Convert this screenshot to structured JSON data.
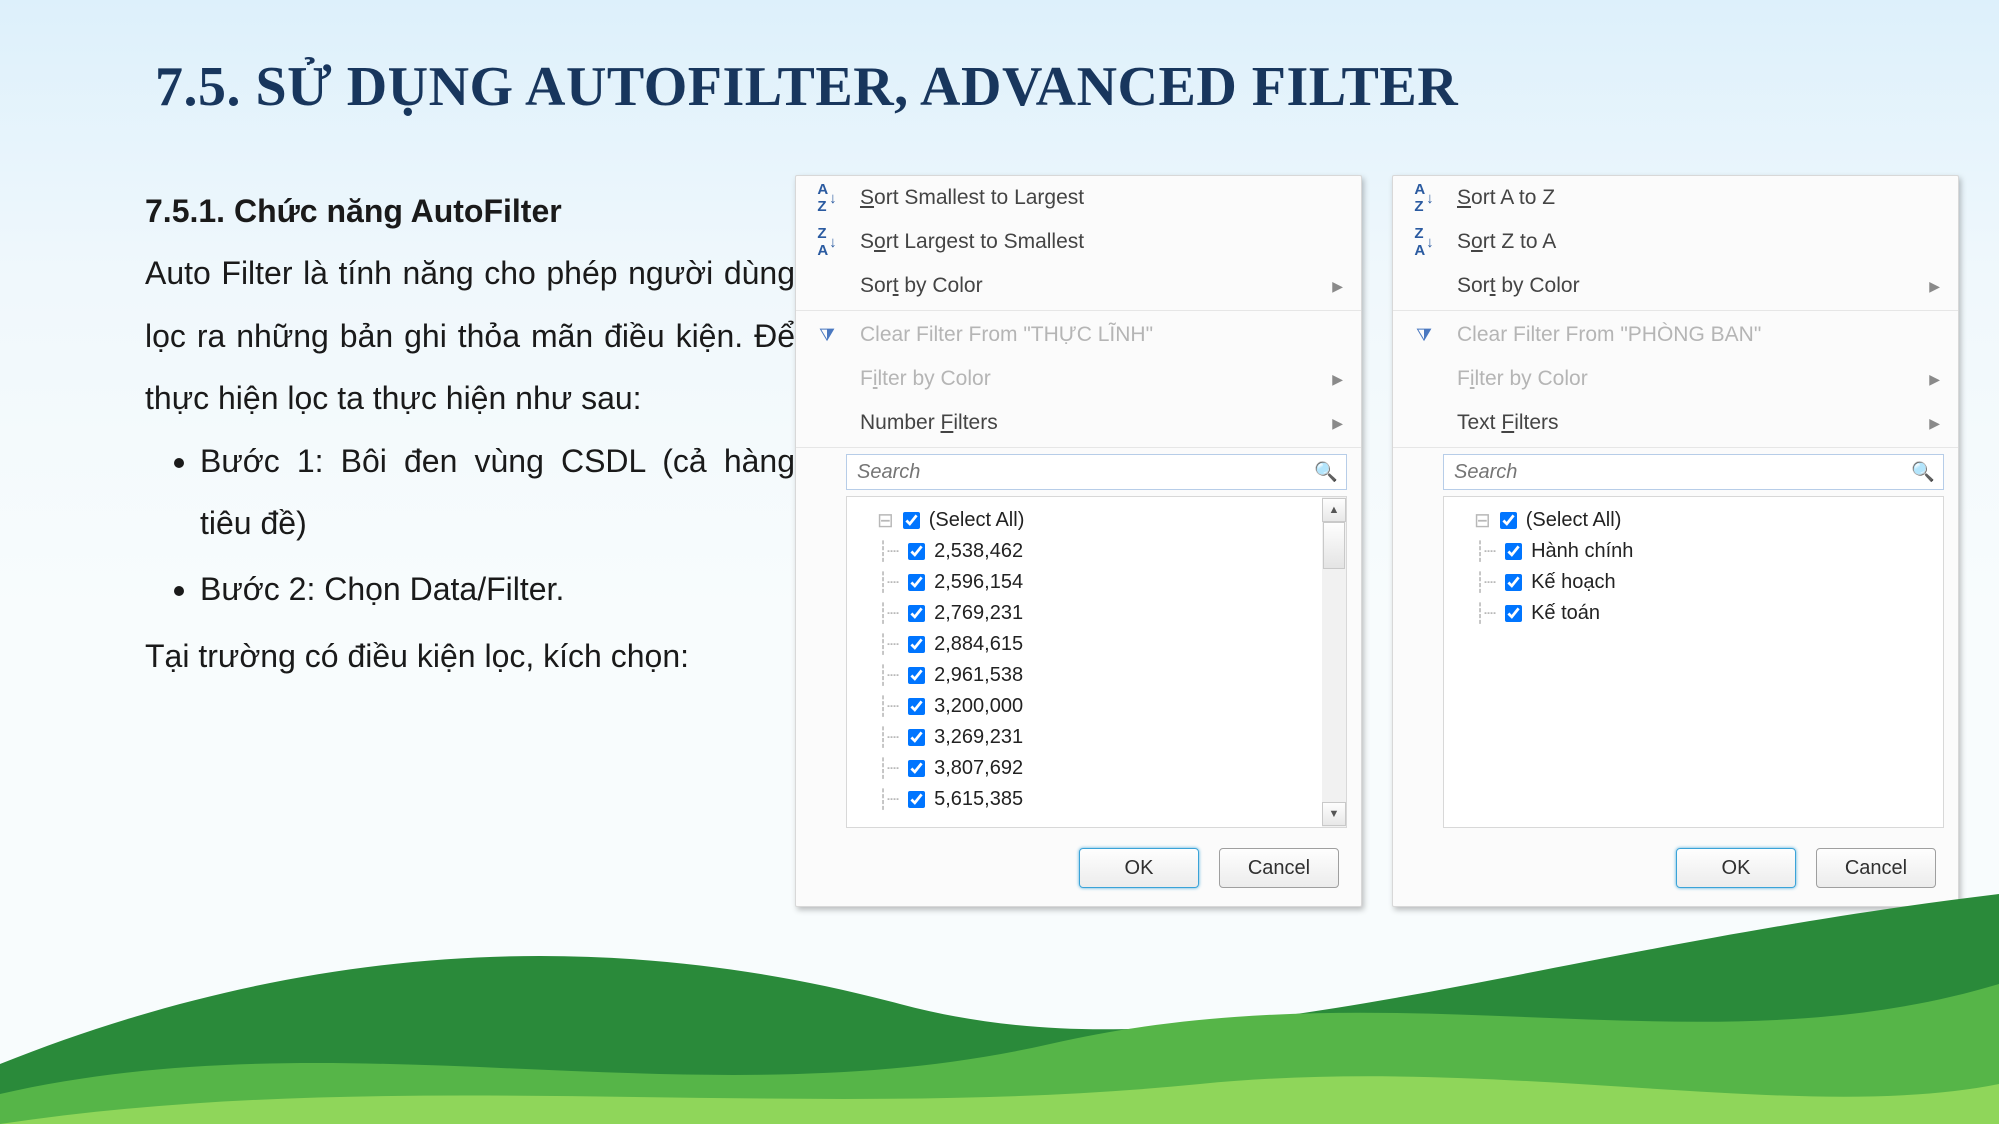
{
  "title": "7.5. SỬ DỤNG AUTOFILTER, ADVANCED FILTER",
  "section": {
    "subtitle": "7.5.1. Chức năng AutoFilter",
    "para1": "Auto Filter là tính năng cho phép người dùng lọc ra những bản ghi thỏa mãn điều kiện. Để thực hiện lọc ta thực hiện như sau:",
    "bullets": [
      "Bước 1: Bôi đen vùng CSDL (cả hàng tiêu đề)",
      "Bước 2: Chọn Data/Filter."
    ],
    "para2": "Tại trường có điều kiện lọc, kích chọn:"
  },
  "panel_left": {
    "sort_asc": "Sort Smallest to Largest",
    "sort_desc": "Sort Largest to Smallest",
    "sort_color": "Sort by Color",
    "clear": "Clear Filter From \"THỰC LĨNH\"",
    "filter_color": "Filter by Color",
    "type_filters": "Number Filters",
    "search_ph": "Search",
    "items": [
      "(Select All)",
      "2,538,462",
      "2,596,154",
      "2,769,231",
      "2,884,615",
      "2,961,538",
      "3,200,000",
      "3,269,231",
      "3,807,692",
      "5,615,385"
    ],
    "ok": "OK",
    "cancel": "Cancel"
  },
  "panel_right": {
    "sort_asc": "Sort A to Z",
    "sort_desc": "Sort Z to A",
    "sort_color": "Sort by Color",
    "clear": "Clear Filter From \"PHÒNG BAN\"",
    "filter_color": "Filter by Color",
    "type_filters": "Text Filters",
    "search_ph": "Search",
    "items": [
      "(Select All)",
      "Hành chính",
      "Kế hoạch",
      "Kế toán"
    ],
    "ok": "OK",
    "cancel": "Cancel"
  }
}
